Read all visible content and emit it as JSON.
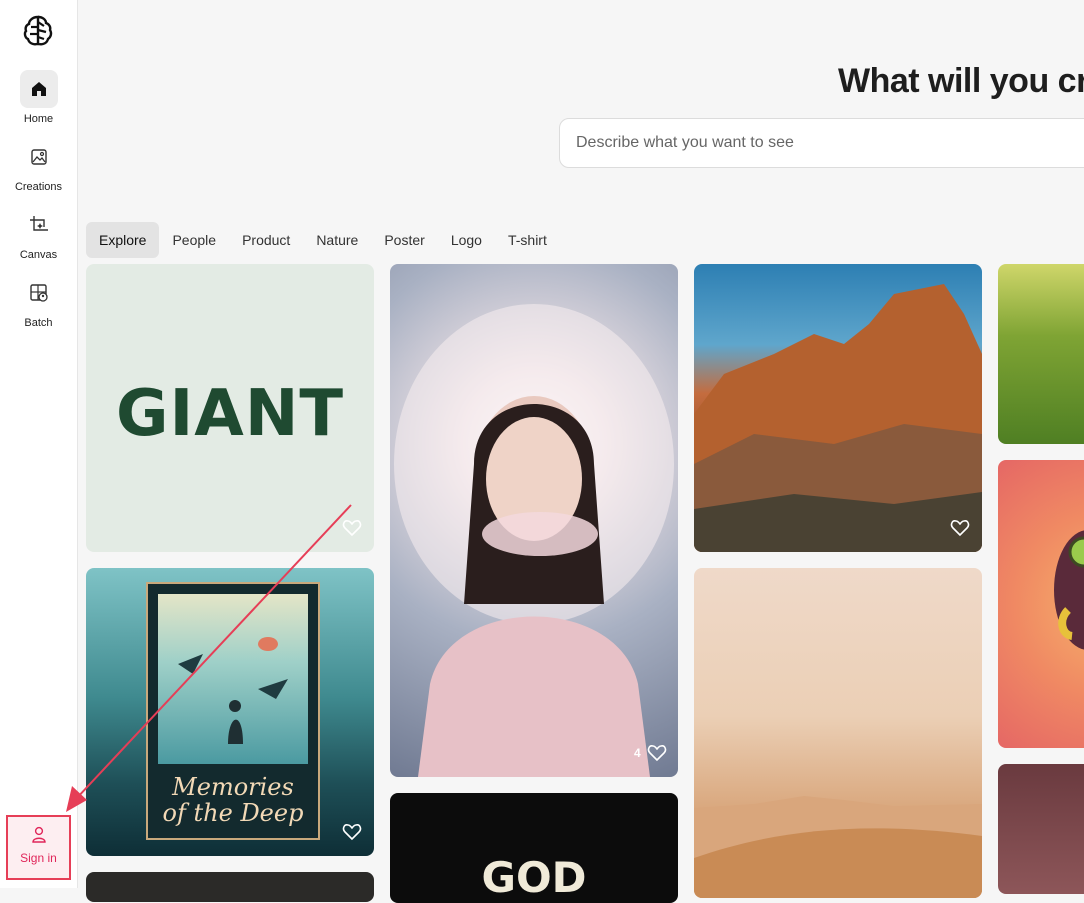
{
  "sidebar": {
    "items": [
      {
        "label": "Home",
        "icon": "home-icon",
        "active": true
      },
      {
        "label": "Creations",
        "icon": "image-icon"
      },
      {
        "label": "Canvas",
        "icon": "crop-sparkle-icon"
      },
      {
        "label": "Batch",
        "icon": "grid-image-icon"
      }
    ],
    "signin_label": "Sign in"
  },
  "main": {
    "heading": "What will you crea",
    "search_placeholder": "Describe what you want to see",
    "tabs": [
      "Explore",
      "People",
      "Product",
      "Nature",
      "Poster",
      "Logo",
      "T-shirt"
    ],
    "active_tab": "Explore"
  },
  "gallery": {
    "giant_logo": "GIANT",
    "poster_title": "Memories of the Deep",
    "poster_title_line1": "Memories",
    "poster_title_line2": "of the Deep",
    "portrait_like_count": "4",
    "dark_logo_text": "GOD"
  },
  "colors": {
    "accent": "#e0265a",
    "annotation_red": "#e63e57"
  }
}
